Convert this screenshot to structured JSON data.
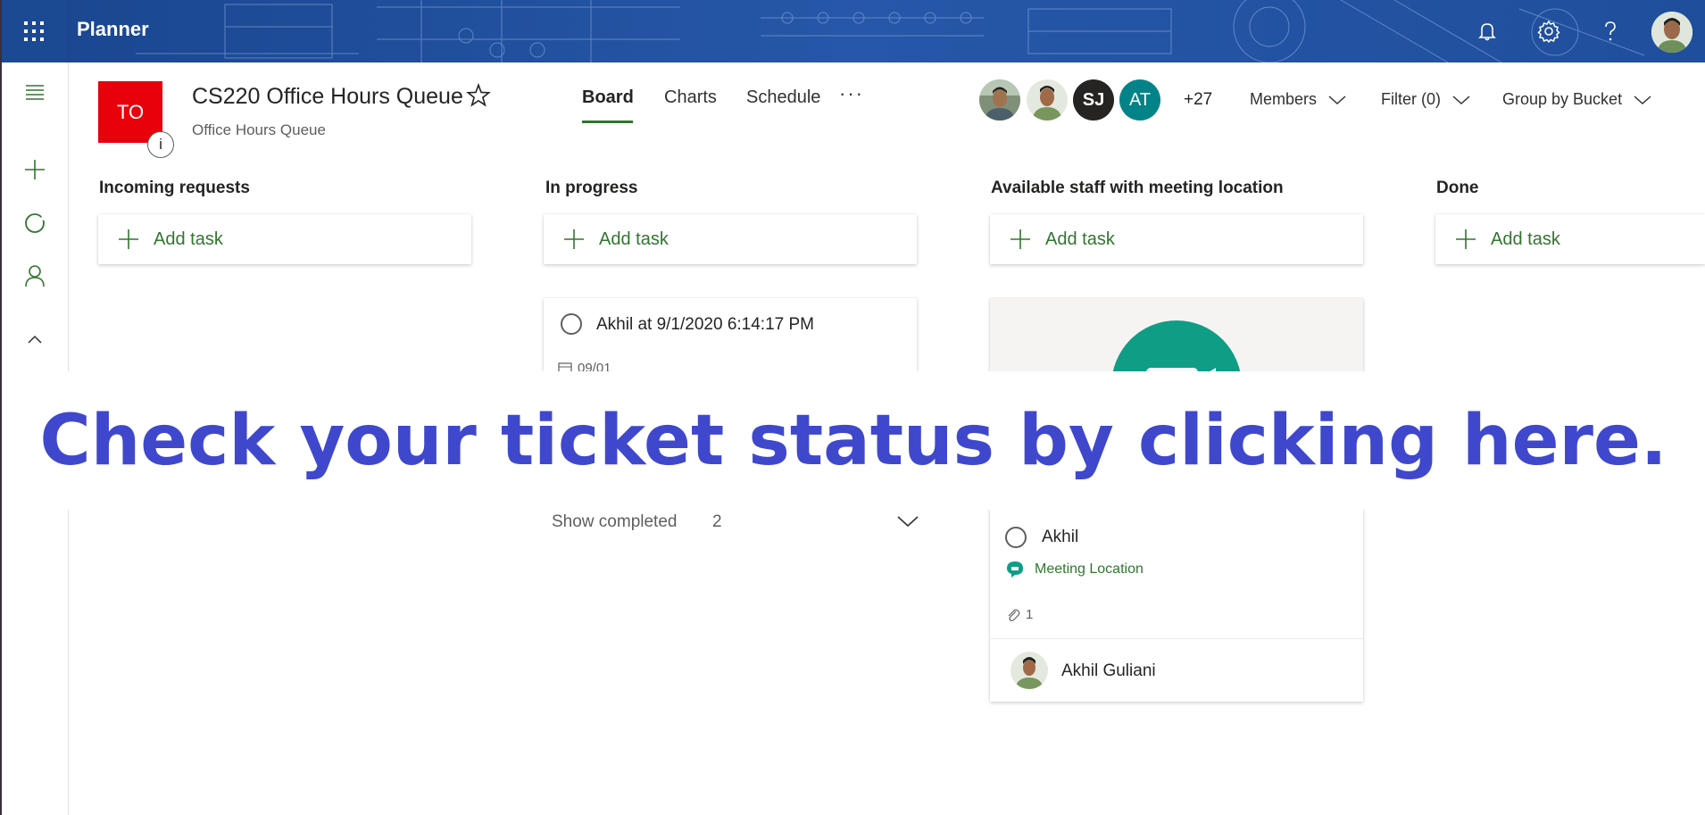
{
  "app": {
    "name": "Planner"
  },
  "plan": {
    "initials": "TO",
    "title": "CS220 Office Hours Queue",
    "subtitle": "Office Hours Queue",
    "info_label": "i"
  },
  "tabs": [
    {
      "label": "Board",
      "active": true
    },
    {
      "label": "Charts",
      "active": false
    },
    {
      "label": "Schedule",
      "active": false
    }
  ],
  "tabs_more": "···",
  "members": {
    "avatars": [
      {
        "kind": "photo",
        "initials": ""
      },
      {
        "kind": "photo",
        "initials": ""
      },
      {
        "kind": "initials",
        "initials": "SJ",
        "color": "#252423"
      },
      {
        "kind": "initials",
        "initials": "AT",
        "color": "#038387"
      }
    ],
    "more": "+27",
    "label": "Members"
  },
  "filter": {
    "label": "Filter (0)"
  },
  "group_by": {
    "label": "Group by Bucket"
  },
  "buckets": [
    {
      "title": "Incoming requests",
      "add_label": "Add task"
    },
    {
      "title": "In progress",
      "add_label": "Add task"
    },
    {
      "title": "Available staff with meeting location",
      "add_label": "Add task"
    },
    {
      "title": "Done",
      "add_label": "Add task"
    }
  ],
  "in_progress_task": {
    "title": "Akhil at 9/1/2020 6:14:17 PM",
    "due": "09/01"
  },
  "show_completed": {
    "label": "Show completed",
    "count": "2"
  },
  "staff_task": {
    "title": "Akhil",
    "link_label": "Meeting Location",
    "attachments": "1",
    "assignee": "Akhil Guliani"
  },
  "left_rail": {
    "plan_initials": "TO"
  },
  "banner": {
    "text": "Check your ticket status by clicking here."
  },
  "colors": {
    "accent": "#31752f",
    "plan_tile": "#e8000b",
    "banner_text": "#3f48cc",
    "suite_bar": "#1f4f9c",
    "meeting_icon": "#0f9d86"
  },
  "icons": {
    "waffle": "waffle-icon",
    "bell": "bell-icon",
    "gear": "gear-icon",
    "help": "help-icon",
    "star": "star-icon",
    "calendar": "calendar-icon",
    "paperclip": "paperclip-icon",
    "chat": "chat-icon"
  }
}
